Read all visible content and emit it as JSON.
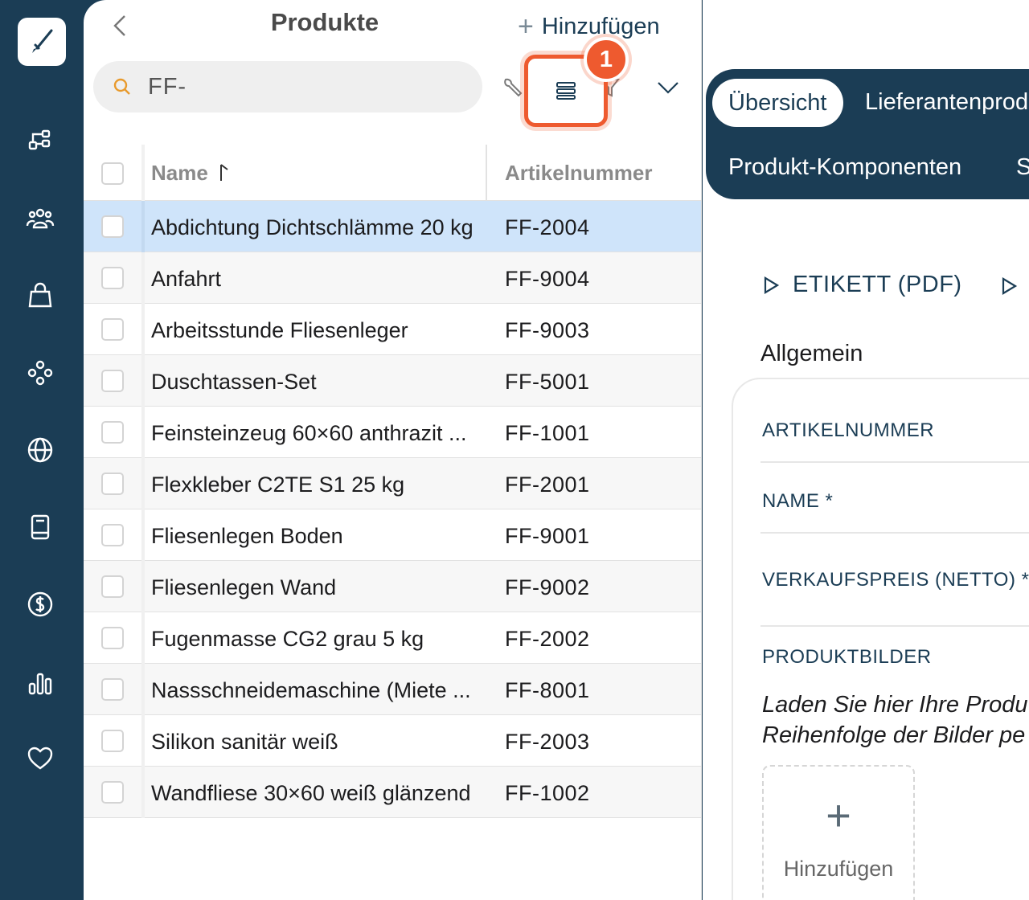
{
  "list": {
    "title": "Produkte",
    "add_label": "Hinzufügen",
    "search_value": "FF-",
    "badge": "1",
    "columns": {
      "name": "Name",
      "article": "Artikelnummer"
    },
    "rows": [
      {
        "name": "Abdichtung Dichtschlämme 20 kg",
        "article": "FF-2004"
      },
      {
        "name": "Anfahrt",
        "article": "FF-9004"
      },
      {
        "name": "Arbeitsstunde Fliesenleger",
        "article": "FF-9003"
      },
      {
        "name": "Duschtassen-Set",
        "article": "FF-5001"
      },
      {
        "name": "Feinsteinzeug 60×60 anthrazit ...",
        "article": "FF-1001"
      },
      {
        "name": "Flexkleber C2TE S1 25 kg",
        "article": "FF-2001"
      },
      {
        "name": "Fliesenlegen Boden",
        "article": "FF-9001"
      },
      {
        "name": "Fliesenlegen Wand",
        "article": "FF-9002"
      },
      {
        "name": "Fugenmasse CG2 grau 5 kg",
        "article": "FF-2002"
      },
      {
        "name": "Nassschneidemaschine (Miete ...",
        "article": "FF-8001"
      },
      {
        "name": "Silikon sanitär weiß",
        "article": "FF-2003"
      },
      {
        "name": "Wandfliese 30×60 weiß glänzend",
        "article": "FF-1002"
      }
    ]
  },
  "detail": {
    "tabs": {
      "overview": "Übersicht",
      "supplier": "Lieferantenprod",
      "components": "Produkt-Komponenten",
      "more": "S"
    },
    "action_label": "ETIKETT (PDF)",
    "section": "Allgemein",
    "fields": {
      "article": "ARTIKELNUMMER",
      "name": "NAME *",
      "price": "VERKAUFSPREIS (NETTO) *",
      "images": "PRODUKTBILDER"
    },
    "hint_line1": "Laden Sie hier Ihre Produ",
    "hint_line2": "Reihenfolge der Bilder pe",
    "upload_label": "Hinzufügen",
    "upload_plus": "+"
  },
  "colors": {
    "navy": "#1b3d55",
    "accent": "#ee5a2f",
    "selected_row": "#cfe4fa"
  }
}
